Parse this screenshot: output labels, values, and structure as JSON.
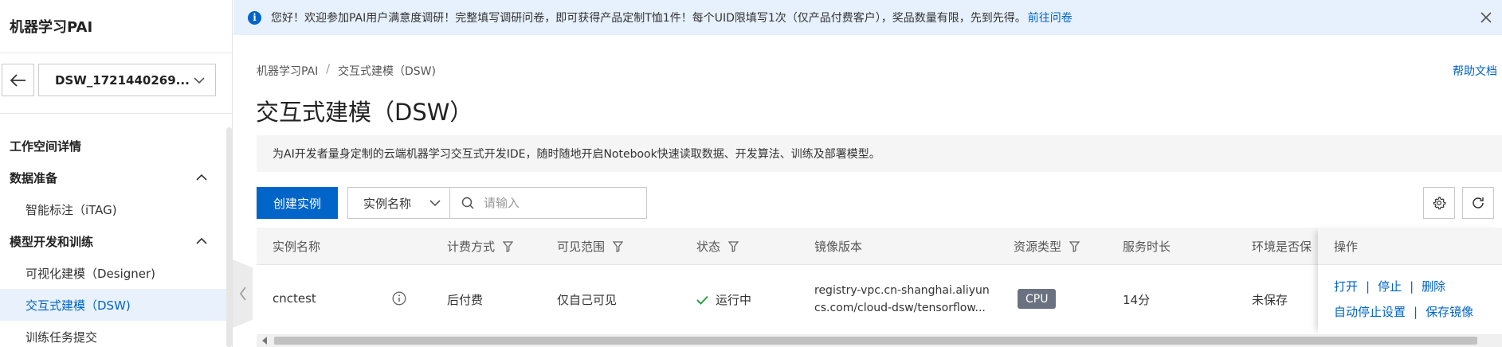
{
  "sidebar": {
    "title": "机器学习PAI",
    "workspace_select": "DSW_1721440269...",
    "items": [
      {
        "label": "工作空间详情",
        "kind": "group"
      },
      {
        "label": "数据准备",
        "kind": "group",
        "expanded": true
      },
      {
        "label": "智能标注（iTAG)",
        "kind": "sub"
      },
      {
        "label": "模型开发和训练",
        "kind": "group",
        "expanded": true
      },
      {
        "label": "可视化建模（Designer)",
        "kind": "sub"
      },
      {
        "label": "交互式建模（DSW)",
        "kind": "sub",
        "active": true
      },
      {
        "label": "训练任务提交",
        "kind": "sub"
      }
    ]
  },
  "notice": {
    "text": "您好！欢迎参加PAI用户满意度调研！完整填写调研问卷，即可获得产品定制T恤1件！每个UID限填写1次（仅产品付费客户），奖品数量有限，先到先得。",
    "link": "前往问卷"
  },
  "breadcrumb": {
    "items": [
      "机器学习PAI",
      "交互式建模（DSW)"
    ],
    "separator": "/"
  },
  "help_link": "帮助文档",
  "page_title": "交互式建模（DSW）",
  "description": "为AI开发者量身定制的云端机器学习交互式开发IDE，随时随地开启Notebook快速读取数据、开发算法、训练及部署模型。",
  "toolbar": {
    "create_label": "创建实例",
    "filter_select": "实例名称",
    "search_placeholder": "请输入"
  },
  "table": {
    "columns": [
      "实例名称",
      "计费方式",
      "可见范围",
      "状态",
      "镜像版本",
      "资源类型",
      "服务时长",
      "环境是否保"
    ],
    "operations_header": "操作",
    "rows": [
      {
        "name": "cnctest",
        "billing": "后付费",
        "visibility": "仅自己可见",
        "status": "运行中",
        "image_line1": "registry-vpc.cn-shanghai.aliyun",
        "image_line2": "cs.com/cloud-dsw/tensorflow...",
        "resource": "CPU",
        "duration": "14分",
        "env_saved": "未保存",
        "ops_line1": [
          "打开",
          "停止",
          "删除"
        ],
        "ops_line2": [
          "自动停止设置",
          "保存镜像"
        ]
      }
    ]
  },
  "colors": {
    "primary": "#0064c8",
    "notice_bg": "#e7f1fd",
    "success": "#2ba245",
    "badge": "#6a7282"
  }
}
